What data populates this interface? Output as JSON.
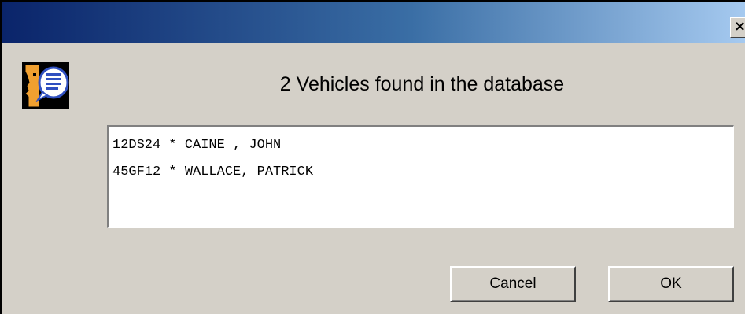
{
  "window": {
    "close_glyph": "×",
    "title_gradient": [
      "#0a246a",
      "#3a6ea5",
      "#a6caf0"
    ]
  },
  "icon": {
    "name": "agent-info-icon"
  },
  "message": {
    "text": "2 Vehicles found in the database"
  },
  "results": {
    "items": [
      "12DS24 * CAINE , JOHN",
      "45GF12 * WALLACE, PATRICK"
    ]
  },
  "buttons": {
    "cancel_label": "Cancel",
    "ok_label": "OK"
  }
}
